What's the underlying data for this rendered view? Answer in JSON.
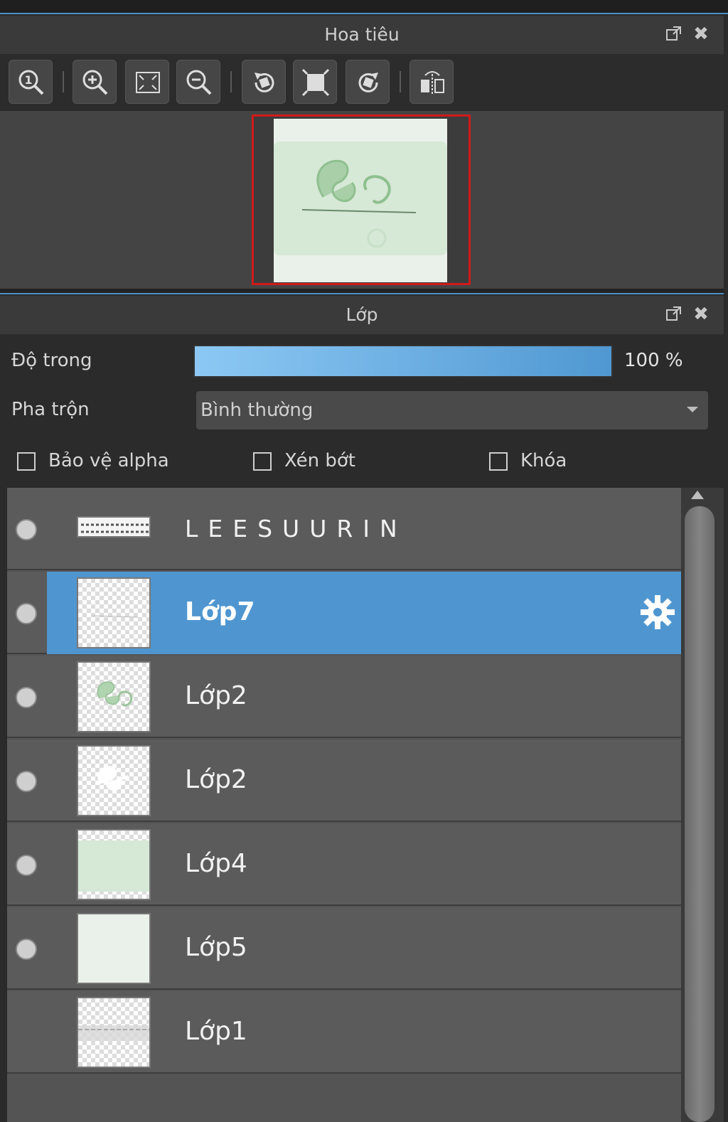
{
  "navigator": {
    "title": "Hoa tiêu",
    "toolbar": [
      {
        "icon": "zoom-actual-icon"
      },
      {
        "icon": "zoom-in-icon"
      },
      {
        "icon": "fit-screen-icon"
      },
      {
        "icon": "zoom-out-icon"
      },
      {
        "icon": "rotate-left-icon"
      },
      {
        "icon": "fit-canvas-icon"
      },
      {
        "icon": "rotate-right-icon"
      },
      {
        "icon": "flip-horizontal-icon"
      }
    ]
  },
  "layers_panel": {
    "title": "Lớp",
    "opacity_label": "Độ trong",
    "opacity_value": "100 %",
    "opacity_level": 1.0,
    "blend_label": "Pha trộn",
    "blend_value": "Bình thường",
    "checks": {
      "protect_alpha": "Bảo vệ alpha",
      "clipping": "Xén bớt",
      "lock": "Khóa"
    },
    "layers": [
      {
        "name": "LEESUURIN",
        "visible": true,
        "selected": false
      },
      {
        "name": "Lớp7",
        "visible": true,
        "selected": true
      },
      {
        "name": "Lớp2",
        "visible": true,
        "selected": false
      },
      {
        "name": "Lớp2",
        "visible": true,
        "selected": false
      },
      {
        "name": "Lớp4",
        "visible": true,
        "selected": false
      },
      {
        "name": "Lớp5",
        "visible": true,
        "selected": false
      },
      {
        "name": "Lớp1",
        "visible": false,
        "selected": false
      }
    ]
  },
  "colors": {
    "accent": "#4f96d0",
    "frame_highlight": "#d01a1a",
    "canvas_green": "#d6e8d6"
  }
}
